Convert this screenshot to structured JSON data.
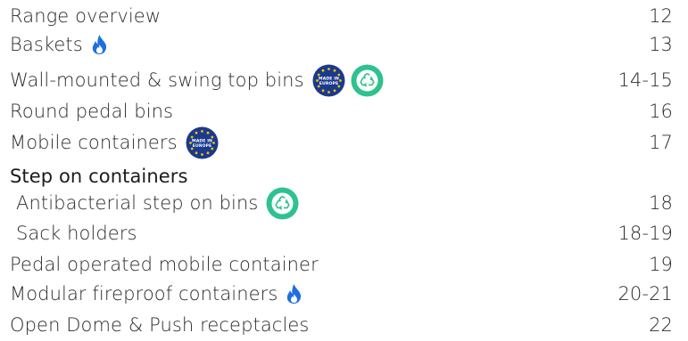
{
  "toc": {
    "items": [
      {
        "title": "Range overview",
        "page": "12",
        "badges": []
      },
      {
        "title": "Baskets",
        "page": "13",
        "badges": [
          "flame-icon"
        ]
      },
      {
        "title": "Wall-mounted & swing top bins",
        "page": "14-15",
        "badges": [
          "made-in-europe-badge",
          "recycle-badge"
        ]
      },
      {
        "title": "Round pedal bins",
        "page": "16",
        "badges": []
      },
      {
        "title": "Mobile containers",
        "page": "17",
        "badges": [
          "made-in-europe-badge"
        ]
      },
      {
        "title": "Step on containers",
        "page": "",
        "badges": []
      },
      {
        "title": "Antibacterial step on bins",
        "page": "18",
        "badges": [
          "recycle-badge"
        ]
      },
      {
        "title": "Sack holders",
        "page": "18-19",
        "badges": []
      },
      {
        "title": "Pedal operated mobile container",
        "page": "19",
        "badges": []
      },
      {
        "title": "Modular fireproof containers",
        "page": "20-21",
        "badges": [
          "flame-icon"
        ]
      },
      {
        "title": "Open Dome & Push receptacles",
        "page": "22",
        "badges": []
      }
    ],
    "badge_text": {
      "made_in_europe": "MADE IN EUROPE"
    }
  },
  "colors": {
    "text": "#2b2b2b",
    "flame_blue": "#1f6fe0",
    "eu_blue": "#1a3a8c",
    "eu_star": "#f3c300",
    "recycle_green": "#2fc18e"
  }
}
